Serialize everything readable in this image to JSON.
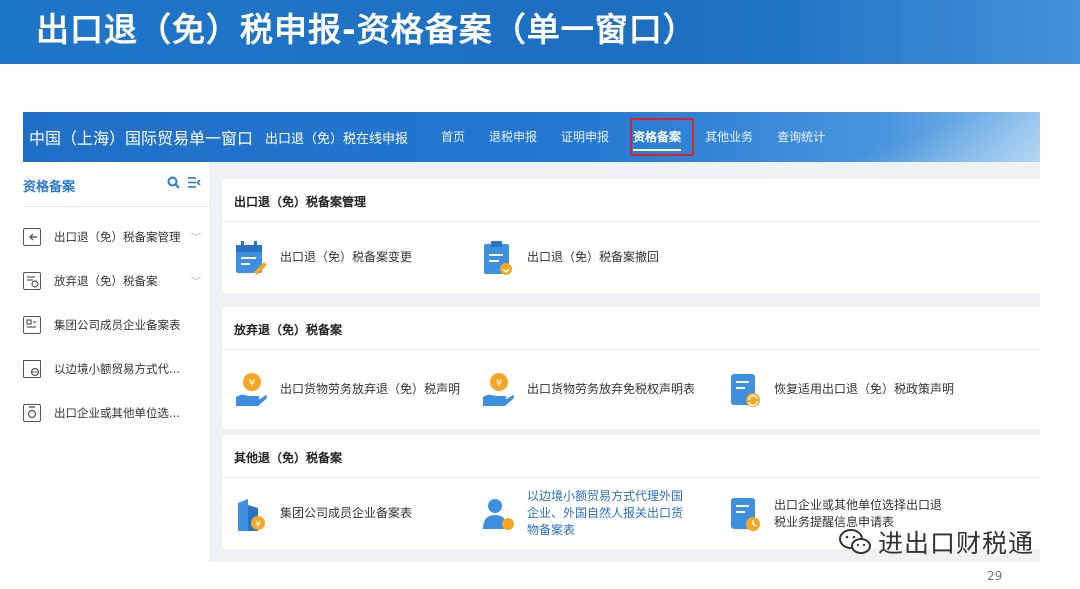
{
  "slide": {
    "title": "出口退（免）税申报-资格备案（单一窗口）",
    "page_number": "29",
    "watermark": "进出口财税通"
  },
  "app": {
    "brand": "中国（上海）国际贸易单一窗口",
    "subbrand": "出口退（免）税在线申报",
    "nav": [
      {
        "label": "首页"
      },
      {
        "label": "退税申报"
      },
      {
        "label": "证明申报"
      },
      {
        "label": "资格备案",
        "active": true
      },
      {
        "label": "其他业务"
      },
      {
        "label": "查询统计"
      }
    ],
    "sidebar": {
      "title": "资格备案",
      "items": [
        {
          "label": "出口退（免）税备案管理",
          "icon": "export-icon",
          "expandable": true
        },
        {
          "label": "放弃退（免）税备案",
          "icon": "document-icon",
          "expandable": true
        },
        {
          "label": "集团公司成员企业备案表",
          "icon": "form-icon"
        },
        {
          "label": "以边境小额贸易方式代...",
          "icon": "folder-globe-icon"
        },
        {
          "label": "出口企业或其他单位选...",
          "icon": "clipboard-icon"
        }
      ]
    },
    "sections": [
      {
        "title": "出口退（免）税备案管理",
        "tiles": [
          {
            "label": "出口退（免）税备案变更",
            "icon": "calendar-edit-icon"
          },
          {
            "label": "出口退（免）税备案撤回",
            "icon": "clipboard-withdraw-icon"
          }
        ]
      },
      {
        "title": "放弃退（免）税备案",
        "tiles": [
          {
            "label": "出口货物劳务放弃退（免）税声明",
            "icon": "hand-coin-icon"
          },
          {
            "label": "出口货物劳务放弃免税权声明表",
            "icon": "hand-coin-icon"
          },
          {
            "label": "恢复适用出口退（免）税政策声明",
            "icon": "document-refresh-icon"
          }
        ]
      },
      {
        "title": "其他退（免）税备案",
        "tiles": [
          {
            "label": "集团公司成员企业备案表",
            "icon": "building-coin-icon"
          },
          {
            "label": "以边境小额贸易方式代理外国企业、外国自然人报关出口货物备案表",
            "icon": "user-coin-icon",
            "link": true
          },
          {
            "label": "出口企业或其他单位选择出口退税业务提醒信息申请表",
            "icon": "document-clock-icon"
          }
        ]
      }
    ]
  },
  "colors": {
    "header_blue": "#1f77c9",
    "accent_blue": "#2a7ad0",
    "icon_orange": "#f5a623",
    "highlight_red": "#e02020"
  }
}
